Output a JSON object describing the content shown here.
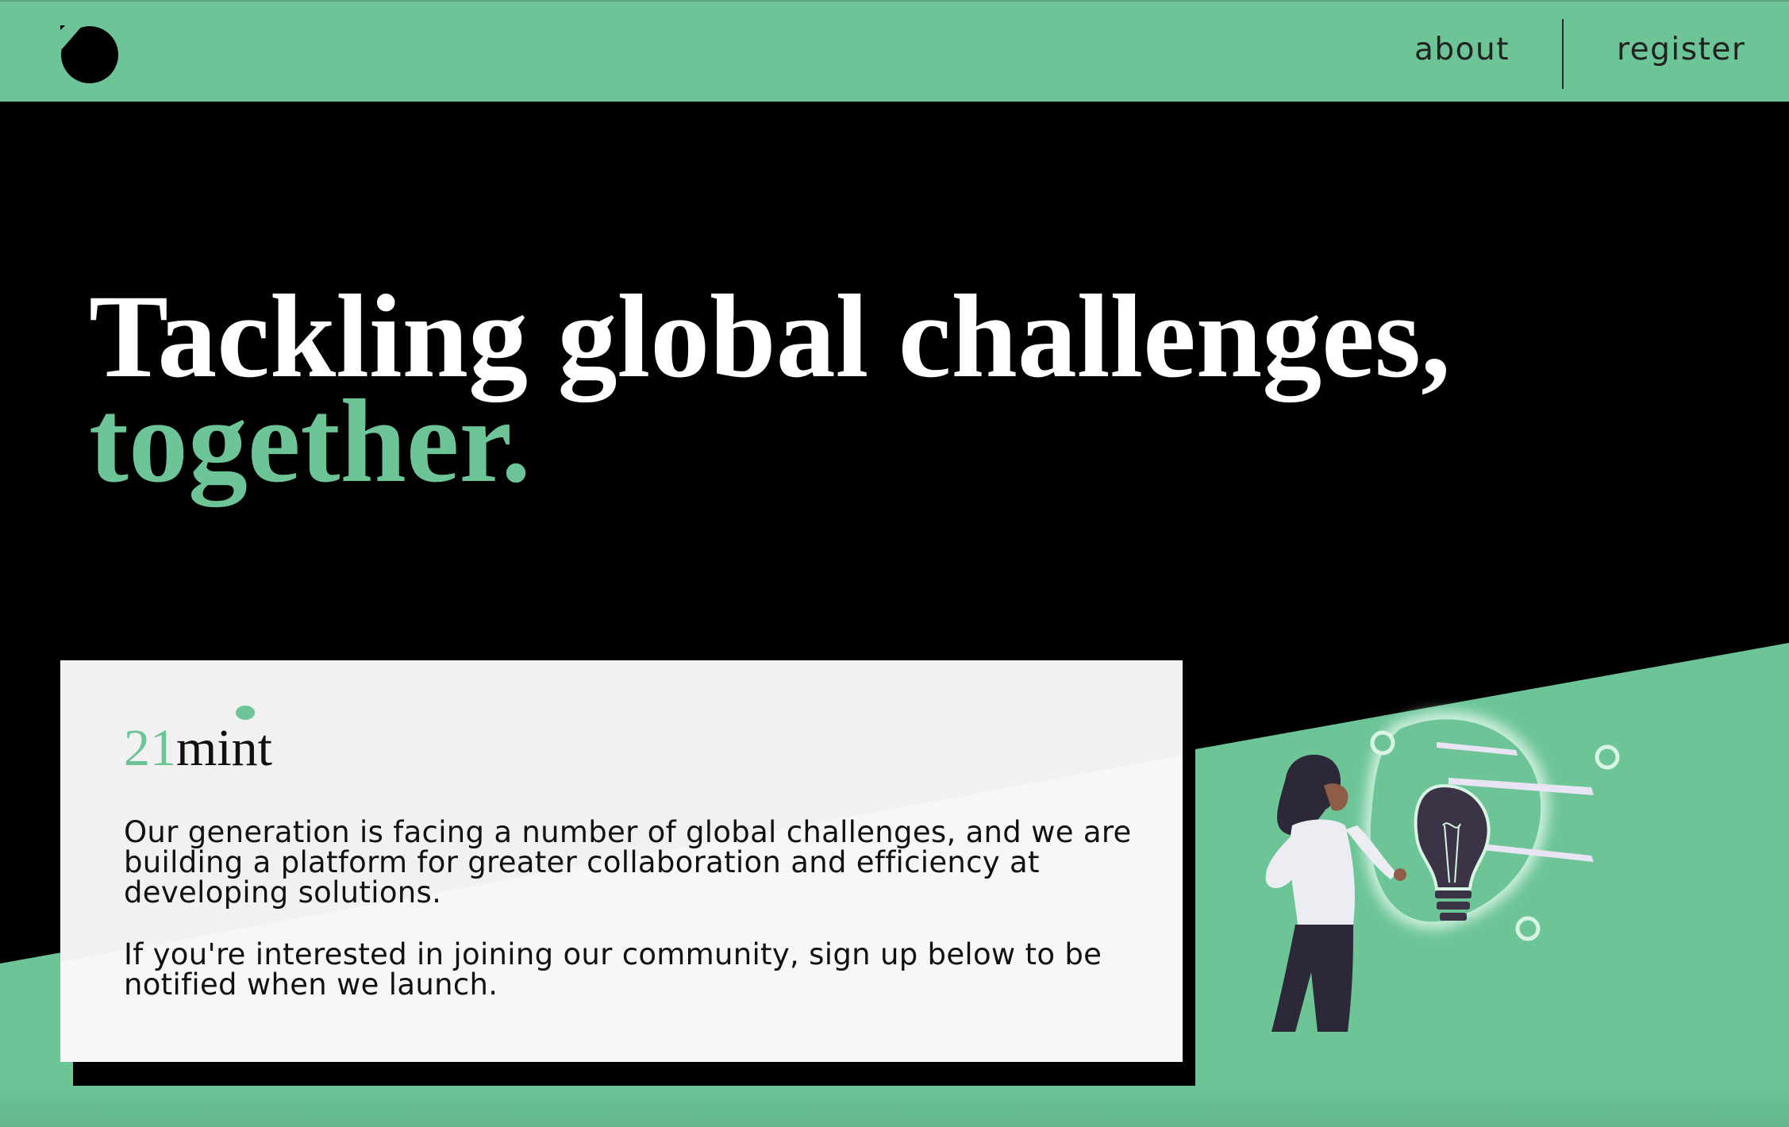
{
  "colors": {
    "accent": "#6cc497",
    "dark": "#000000",
    "card": "#f6f8f7",
    "nav_text": "#222222"
  },
  "nav": {
    "logo_icon": "circle-logo-icon",
    "links": [
      {
        "label": "about"
      },
      {
        "label": "register"
      }
    ]
  },
  "hero": {
    "headline_line1": "Tackling global challenges,",
    "headline_line2": "together."
  },
  "card": {
    "brand_number": "21",
    "brand_word": "mint",
    "paragraph1": "Our generation is facing a number of global challenges, and we are building a platform for greater collaboration and efficiency at developing solutions.",
    "paragraph2": "If you're interested in joining our community, sign up below to be notified when we launch."
  },
  "illustration": {
    "icon": "woman-with-lightbulb-illustration"
  }
}
